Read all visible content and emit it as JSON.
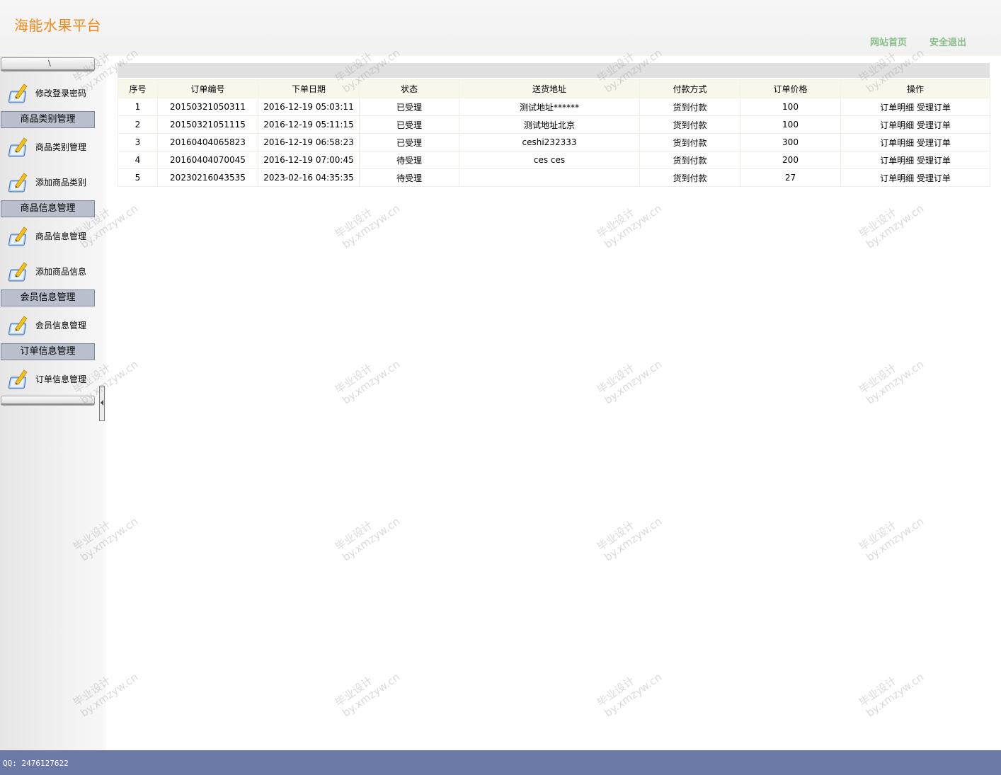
{
  "header": {
    "title": "海能水果平台",
    "links": [
      {
        "label": "网站首页"
      },
      {
        "label": "安全退出"
      }
    ]
  },
  "sidebar": {
    "scroll_up_glyph": "\\",
    "top_item": {
      "label": "修改登录密码"
    },
    "sections": [
      {
        "title": "商品类别管理",
        "items": [
          {
            "label": "商品类别管理"
          },
          {
            "label": "添加商品类别"
          }
        ]
      },
      {
        "title": "商品信息管理",
        "items": [
          {
            "label": "商品信息管理"
          },
          {
            "label": "添加商品信息"
          }
        ]
      },
      {
        "title": "会员信息管理",
        "items": [
          {
            "label": "会员信息管理"
          }
        ]
      },
      {
        "title": "订单信息管理",
        "items": [
          {
            "label": "订单信息管理"
          }
        ]
      }
    ]
  },
  "table": {
    "columns": [
      "序号",
      "订单编号",
      "下单日期",
      "状态",
      "送货地址",
      "付款方式",
      "订单价格",
      "操作"
    ],
    "rows": [
      {
        "index": "1",
        "order_no": "20150321050311",
        "date": "2016-12-19 05:03:11",
        "status": "已受理",
        "address": "测试地址******",
        "payment": "货到付款",
        "price": "100",
        "actions": [
          "订单明细",
          "受理订单"
        ]
      },
      {
        "index": "2",
        "order_no": "20150321051115",
        "date": "2016-12-19 05:11:15",
        "status": "已受理",
        "address": "测试地址北京",
        "payment": "货到付款",
        "price": "100",
        "actions": [
          "订单明细",
          "受理订单"
        ]
      },
      {
        "index": "3",
        "order_no": "20160404065823",
        "date": "2016-12-19 06:58:23",
        "status": "已受理",
        "address": "ceshi232333",
        "payment": "货到付款",
        "price": "300",
        "actions": [
          "订单明细",
          "受理订单"
        ]
      },
      {
        "index": "4",
        "order_no": "20160404070045",
        "date": "2016-12-19 07:00:45",
        "status": "待受理",
        "address": "ces ces",
        "payment": "货到付款",
        "price": "200",
        "actions": [
          "订单明细",
          "受理订单"
        ]
      },
      {
        "index": "5",
        "order_no": "20230216043535",
        "date": "2023-02-16 04:35:35",
        "status": "待受理",
        "address": "",
        "payment": "货到付款",
        "price": "27",
        "actions": [
          "订单明细",
          "受理订单"
        ]
      }
    ]
  },
  "watermark": {
    "line1": "毕业设计",
    "line2": "by.xmzyw.cn"
  },
  "footer": {
    "text": "QQ: 2476127622"
  },
  "colors": {
    "title": "#f08a1c",
    "top_links": "#8abf8a",
    "footer": "#6b7aa6",
    "section_header": "#b9bfcc"
  },
  "icons": {
    "menu_item": "pencil-notepad-icon"
  }
}
